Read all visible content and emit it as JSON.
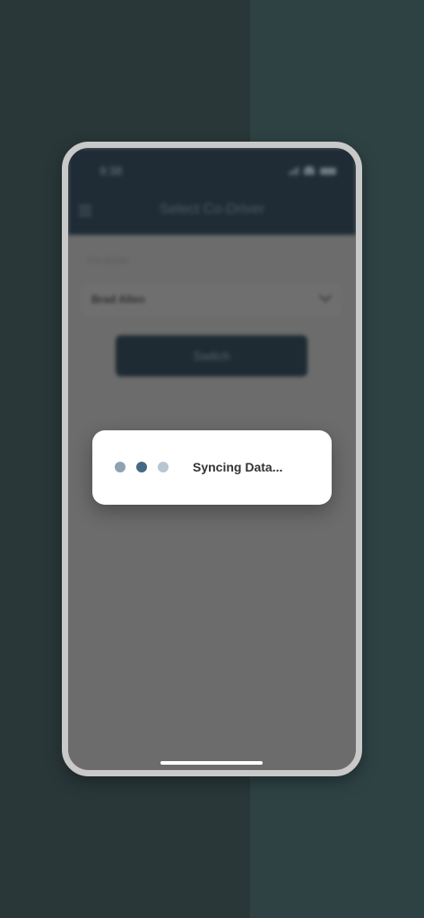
{
  "status_bar": {
    "time": "9:38"
  },
  "app": {
    "title": "Select Co-Driver",
    "field_label": "Co-driver",
    "selected_co_driver": "Brad Allen",
    "switch_label": "Switch"
  },
  "dialog": {
    "message": "Syncing Data...",
    "dot_colors": [
      "#8fa2b2",
      "#456985",
      "#b9c6d1"
    ]
  },
  "colors": {
    "app_bar": "#1f2c35",
    "overlay": "#6c6c6c",
    "background_left": "#293739",
    "background_right": "#2e4244"
  }
}
